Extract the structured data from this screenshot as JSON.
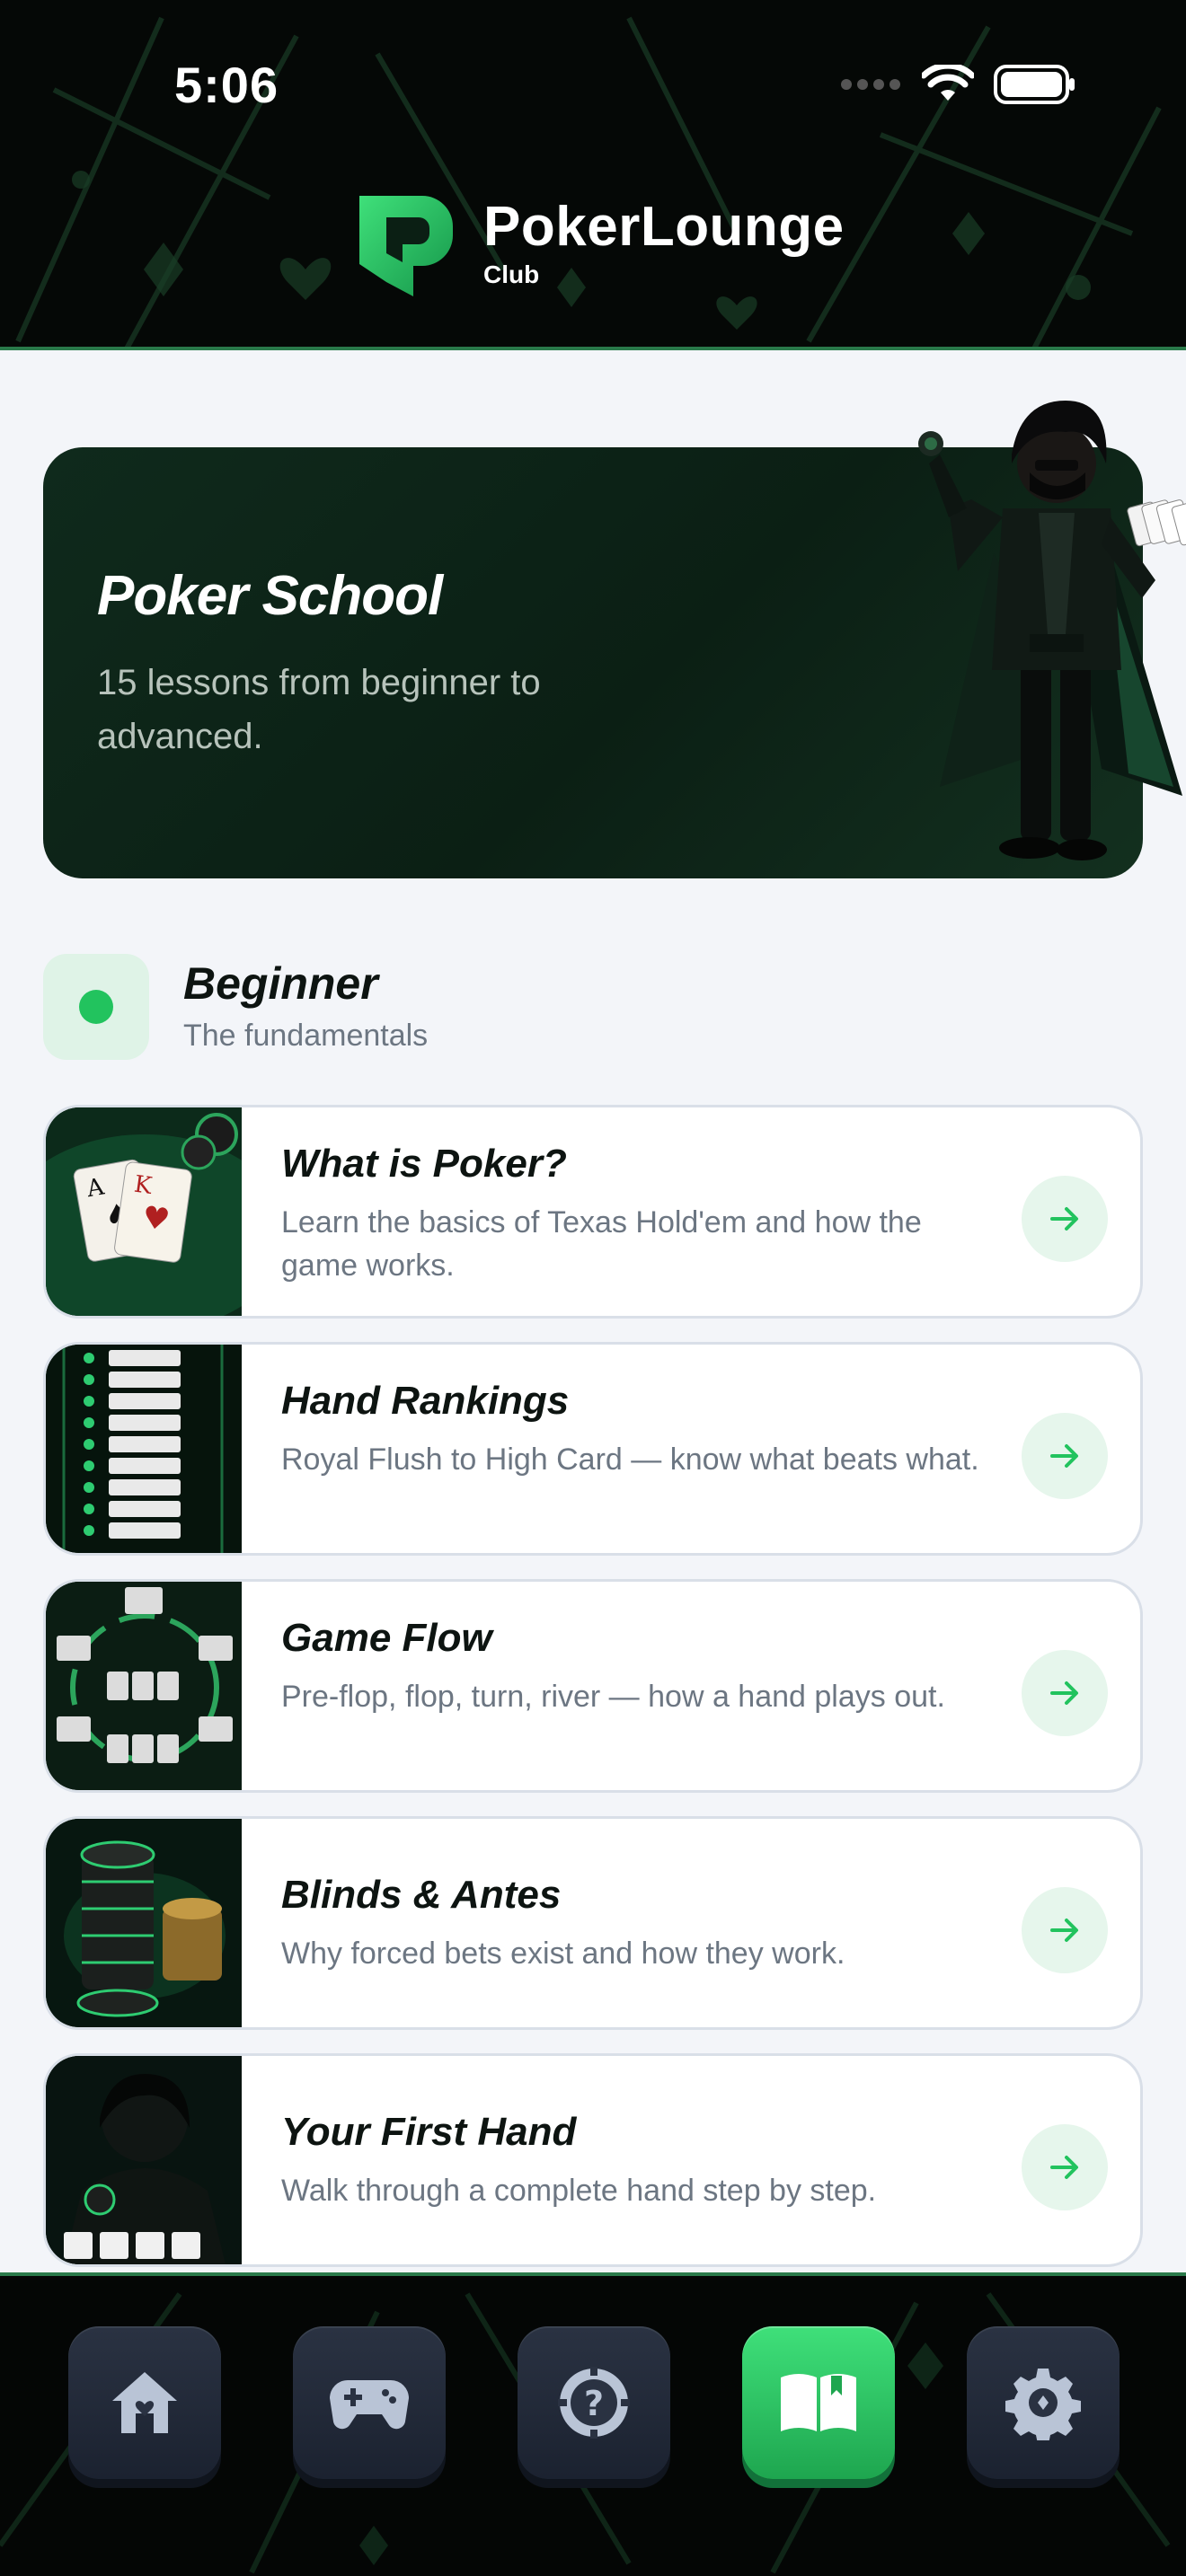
{
  "status_bar": {
    "time": "5:06"
  },
  "brand": {
    "name": "PokerLounge",
    "sub": "Club"
  },
  "hero": {
    "title": "Poker School",
    "subtitle": "15 lessons from beginner to advanced."
  },
  "section": {
    "title": "Beginner",
    "subtitle": "The fundamentals"
  },
  "lessons": [
    {
      "title": "What is Poker?",
      "description": "Learn the basics of Texas Hold'em and how the game works."
    },
    {
      "title": "Hand Rankings",
      "description": "Royal Flush to High Card — know what beats what."
    },
    {
      "title": "Game Flow",
      "description": "Pre-flop, flop, turn, river — how a hand plays out."
    },
    {
      "title": "Blinds & Antes",
      "description": "Why forced bets exist and how they work."
    },
    {
      "title": "Your First Hand",
      "description": "Walk through a complete hand step by step."
    }
  ],
  "nav": {
    "items": [
      {
        "icon": "home-icon",
        "active": false
      },
      {
        "icon": "gamepad-icon",
        "active": false
      },
      {
        "icon": "help-chip-icon",
        "active": false
      },
      {
        "icon": "book-icon",
        "active": true
      },
      {
        "icon": "gear-icon",
        "active": false
      }
    ]
  },
  "colors": {
    "accent": "#22c35e",
    "hero_bg": "#0b1f14",
    "header_bg": "#050806",
    "page_bg": "#f3f5f9"
  }
}
